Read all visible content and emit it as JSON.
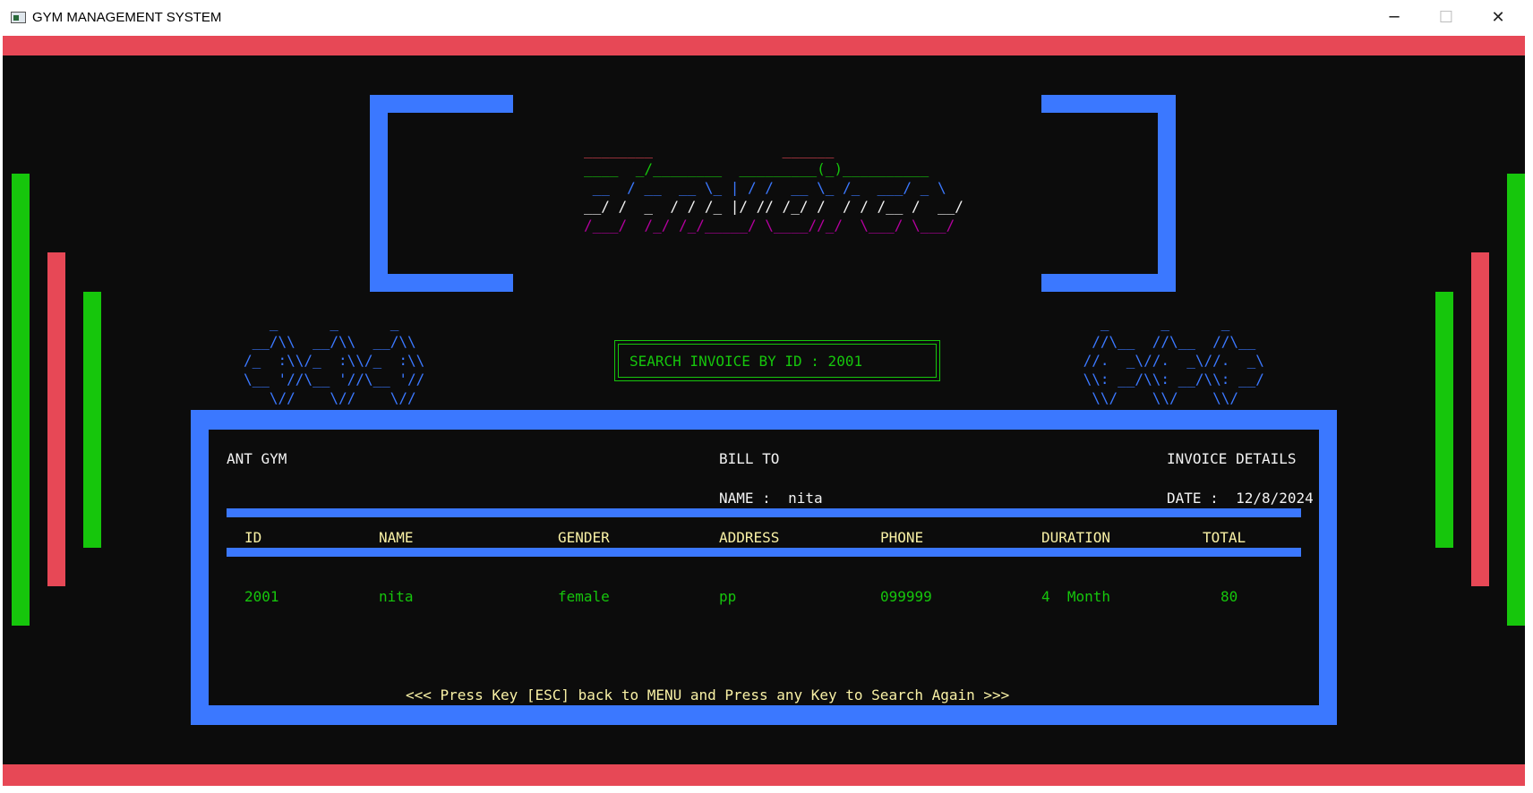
{
  "window": {
    "title": "GYM MANAGEMENT SYSTEM",
    "minimize_glyph": "─",
    "maximize_glyph": "☐",
    "close_glyph": "✕"
  },
  "colors": {
    "console_bg": "#0c0c0c",
    "red": "#e74856",
    "green": "#16c60c",
    "blue": "#3b78ff",
    "yellow": "#f9f1a5",
    "magenta": "#b4009e"
  },
  "logo": {
    "line1": "________               ______",
    "line2": "____  _/________  _________(_)__________",
    "line3": " __  / __  __ \\_ | / /  __ \\_ /_  ___/ _ \\",
    "line4": "__/ /  _  / / /_ |/ // /_/ /  / / /__ /  __/",
    "line5": "/___/  /_/ /_/_____/ \\____//_/  \\___/ \\___/"
  },
  "deco_left": {
    "line1": "   _      _      _",
    "line2": " __/\\\\  __/\\\\  __/\\\\",
    "line3": "/_  :\\\\/_  :\\\\/_  :\\\\",
    "line4": "\\__ '//\\__ '//\\__ '//",
    "line5": "   \\//    \\//    \\//"
  },
  "deco_right": {
    "line1": "   _      _      _",
    "line2": "  //\\__  //\\__  //\\__",
    "line3": " //.  _\\//.  _\\//.  _\\",
    "line4": " \\\\: __/\\\\: __/\\\\: __/",
    "line5": "  \\\\/    \\\\/    \\\\/"
  },
  "search": {
    "label": "SEARCH INVOICE BY ID : 2001"
  },
  "invoice": {
    "company": "ANT GYM",
    "bill_to": "BILL TO",
    "details_title": "INVOICE DETAILS",
    "name_line": "NAME :  nita",
    "date_line": "DATE :  12/8/2024",
    "columns": [
      "ID",
      "NAME",
      "GENDER",
      "ADDRESS",
      "PHONE",
      "DURATION",
      "TOTAL"
    ],
    "row": {
      "id": "2001",
      "name": "nita",
      "gender": "female",
      "address": "pp",
      "phone": "099999",
      "duration": "4  Month",
      "total": "80"
    },
    "footer": "<<< Press Key [ESC] back to MENU and Press any Key to Search Again >>>"
  }
}
